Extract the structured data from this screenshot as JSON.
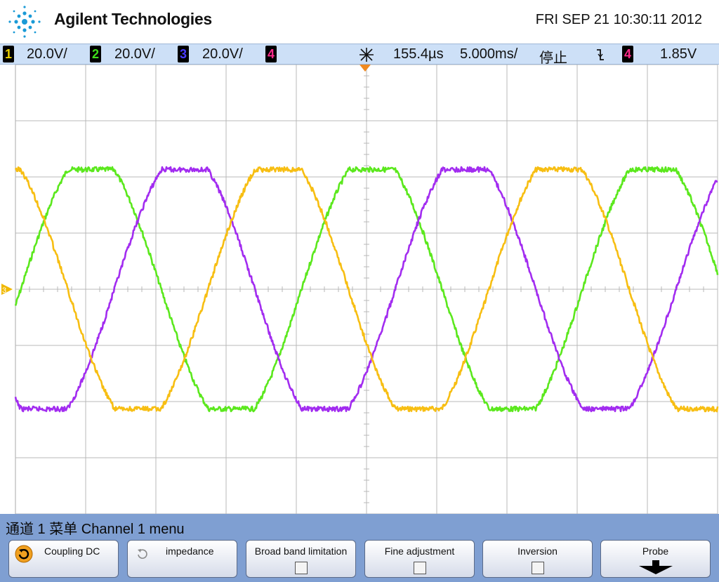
{
  "header": {
    "brand": "Agilent Technologies",
    "datetime": "FRI SEP 21 10:30:11 2012",
    "logo_icon": "agilent-spark-logo"
  },
  "status": {
    "channels": [
      {
        "num": "1",
        "scale": "20.0V/",
        "color": "#e9d000"
      },
      {
        "num": "2",
        "scale": "20.0V/",
        "color": "#3ee01a"
      },
      {
        "num": "3",
        "scale": "20.0V/",
        "color": "#4a3cff"
      },
      {
        "num": "4",
        "scale": "",
        "color": "#ff2a8c"
      }
    ],
    "delay": "155.4µs",
    "timebase": "5.000ms/",
    "run_state": "停止",
    "trigger_source": "4",
    "trigger_level": "1.85V"
  },
  "menu": {
    "title": "通道 1  菜单 Channel 1 menu",
    "softkeys": [
      {
        "label": "Coupling DC",
        "icon": "rotate-icon"
      },
      {
        "label": "impedance",
        "icon": "rotate-icon"
      },
      {
        "label": "Broad band limitation",
        "icon": "checkbox-icon"
      },
      {
        "label": "Fine adjustment",
        "icon": "checkbox-icon"
      },
      {
        "label": "Inversion",
        "icon": "checkbox-icon"
      },
      {
        "label": "Probe",
        "icon": "arrow-down-icon"
      }
    ]
  },
  "colors": {
    "ch_yellow": "#f7be12",
    "ch_green": "#5be81d",
    "ch_purple": "#a22cf0",
    "grid": "#b8b8b8"
  }
}
